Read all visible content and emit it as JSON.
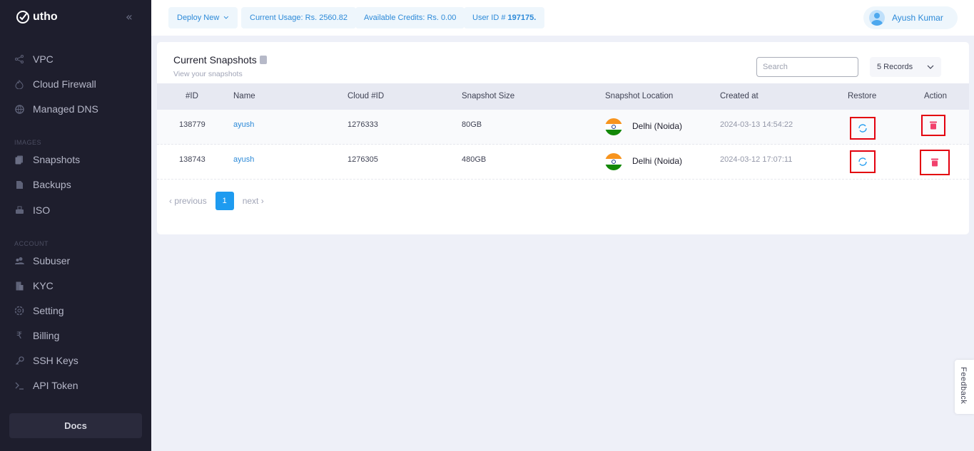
{
  "brand": {
    "name": "utho"
  },
  "sidebar": {
    "items": [
      {
        "label": "VPC",
        "icon": "share-nodes-icon"
      },
      {
        "label": "Cloud Firewall",
        "icon": "fire-icon"
      },
      {
        "label": "Managed DNS",
        "icon": "globe-icon"
      },
      {
        "label": "Snapshots",
        "icon": "copy-icon"
      },
      {
        "label": "Backups",
        "icon": "file-icon"
      },
      {
        "label": "ISO",
        "icon": "disc-icon"
      },
      {
        "label": "Subuser",
        "icon": "users-icon"
      },
      {
        "label": "KYC",
        "icon": "id-card-icon"
      },
      {
        "label": "Setting",
        "icon": "gear-icon"
      },
      {
        "label": "Billing",
        "icon": "rupee-icon"
      },
      {
        "label": "SSH Keys",
        "icon": "key-icon"
      },
      {
        "label": "API Token",
        "icon": "terminal-icon"
      }
    ],
    "sections": {
      "images": "IMAGES",
      "account": "ACCOUNT"
    },
    "docs_label": "Docs"
  },
  "header": {
    "deploy_label": "Deploy New",
    "usage_label": "Current Usage: Rs. 2560.82",
    "credits_label": "Available Credits: Rs. 0.00",
    "user_id_prefix": "User ID # ",
    "user_id": "197175.",
    "user_name": "Ayush Kumar"
  },
  "main": {
    "title": "Current Snapshots",
    "subtitle": "View your snapshots",
    "search_placeholder": "Search",
    "records_label": "5 Records",
    "columns": [
      "#ID",
      "Name",
      "Cloud #ID",
      "Snapshot Size",
      "Snapshot Location",
      "Created at",
      "Restore",
      "Action"
    ],
    "rows": [
      {
        "id": "138779",
        "name": "ayush",
        "cloud_id": "1276333",
        "size": "80GB",
        "location": "Delhi (Noida)",
        "created": "2024-03-13 14:54:22"
      },
      {
        "id": "138743",
        "name": "ayush",
        "cloud_id": "1276305",
        "size": "480GB",
        "location": "Delhi (Noida)",
        "created": "2024-03-12 17:07:11"
      }
    ],
    "pagination": {
      "previous": "‹ previous",
      "current": "1",
      "next": "next ›"
    }
  },
  "feedback_label": "Feedback",
  "colors": {
    "sidebar_bg": "#1e1e2d",
    "accent": "#1e9bf0",
    "danger": "#f1416c",
    "highlight": "#e3000f"
  }
}
